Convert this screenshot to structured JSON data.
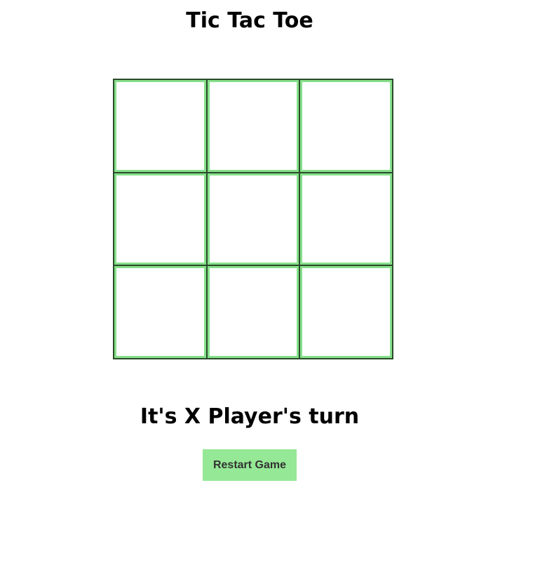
{
  "game": {
    "title": "Tic Tac Toe",
    "status": "It's X Player's turn",
    "restart_label": "Restart Game",
    "board": [
      "",
      "",
      "",
      "",
      "",
      "",
      "",
      "",
      ""
    ]
  },
  "colors": {
    "cell_border": "#86e08a",
    "grid_line": "#2b4a2b",
    "button_bg": "#95e895",
    "button_text": "#333333",
    "text": "#000000"
  }
}
